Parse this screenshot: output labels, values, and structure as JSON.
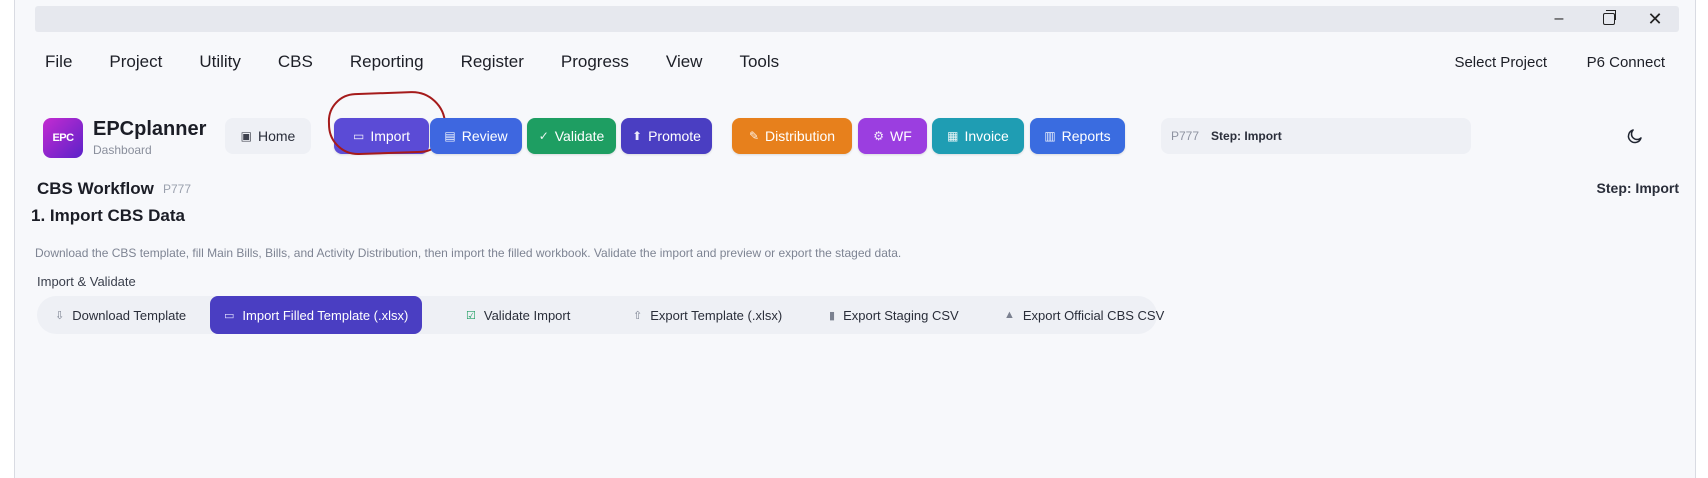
{
  "window": {
    "controls": {
      "minimize": "–",
      "maximize": "",
      "close": "✕"
    }
  },
  "menu": {
    "items": [
      "File",
      "Project",
      "Utility",
      "CBS",
      "Reporting",
      "Register",
      "Progress",
      "View",
      "Tools"
    ],
    "right": {
      "select_project": "Select Project",
      "p6_connect": "P6 Connect"
    }
  },
  "brand": {
    "logo_text": "EPC",
    "title": "EPCplanner",
    "subtitle": "Dashboard"
  },
  "toolbar": {
    "home": "Home",
    "import": "Import",
    "review": "Review",
    "validate": "Validate",
    "promote": "Promote",
    "distribution": "Distribution",
    "wf": "WF",
    "invoice": "Invoice",
    "reports": "Reports",
    "project_id": "P777",
    "step": "Step: Import"
  },
  "workflow": {
    "title": "CBS Workflow",
    "project_id": "P777",
    "step": "Step: Import",
    "section_title": "1. Import CBS Data",
    "description": "Download the CBS template, fill Main Bills, Bills, and Activity Distribution, then import the filled workbook. Validate the import and preview or export the staged data.",
    "group_label": "Import & Validate",
    "actions": {
      "download_template": "Download Template",
      "import_filled": "Import Filled Template (.xlsx)",
      "validate_import": "Validate Import",
      "export_template": "Export Template (.xlsx)",
      "export_staging": "Export Staging CSV",
      "export_official": "Export Official CBS CSV"
    }
  },
  "colors": {
    "import": "#5b4bd6",
    "review": "#3e67e0",
    "validate": "#1e9e62",
    "promote": "#4a3ec2",
    "distribution": "#e7801c",
    "wf": "#9b3ee0",
    "invoice": "#1f9db3",
    "reports": "#3a6ce0",
    "annotation_circle": "#a51b1b"
  }
}
